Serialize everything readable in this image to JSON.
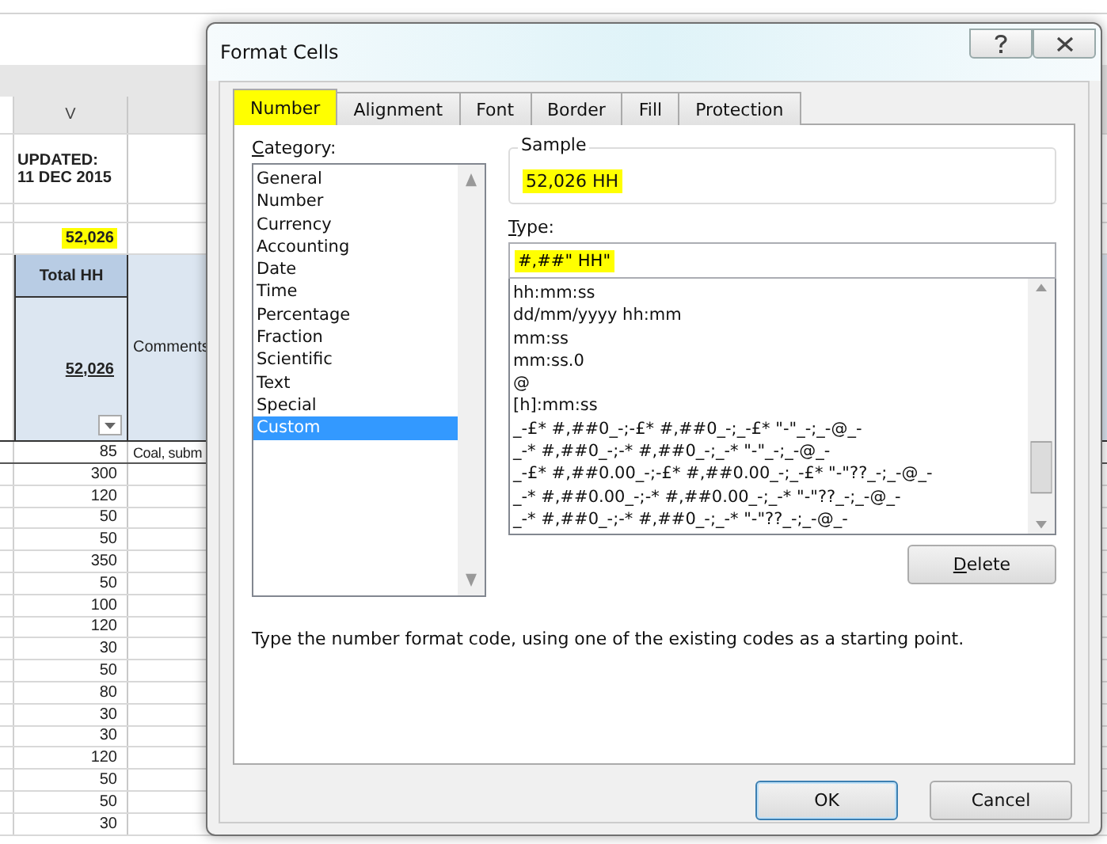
{
  "sheet": {
    "column_header": "V",
    "updated_label": "UPDATED:",
    "updated_date": "11 DEC 2015",
    "top_total": {
      "text": "52,026",
      "highlighted": true
    },
    "header": {
      "title": "Total HH",
      "total": "52,026",
      "comments_label": "Comments"
    },
    "rows": [
      {
        "total": "85",
        "comment": "Coal, subm"
      },
      {
        "total": "300"
      },
      {
        "total": "120"
      },
      {
        "total": "50"
      },
      {
        "total": "50"
      },
      {
        "total": "350"
      },
      {
        "total": "50"
      },
      {
        "total": "100"
      },
      {
        "total": "120"
      },
      {
        "total": "30"
      },
      {
        "total": "50"
      },
      {
        "total": "80"
      },
      {
        "total": "30"
      },
      {
        "total": "30"
      },
      {
        "total": "120"
      },
      {
        "total": "50"
      },
      {
        "total": "50"
      },
      {
        "total": "30"
      }
    ]
  },
  "dialog": {
    "title": "Format Cells",
    "tabs": [
      {
        "label": "Number",
        "selected": true,
        "highlighted": true
      },
      {
        "label": "Alignment",
        "selected": false,
        "highlighted": false
      },
      {
        "label": "Font",
        "selected": false,
        "highlighted": false
      },
      {
        "label": "Border",
        "selected": false,
        "highlighted": false
      },
      {
        "label": "Fill",
        "selected": false,
        "highlighted": false
      },
      {
        "label": "Protection",
        "selected": false,
        "highlighted": false
      }
    ],
    "category_label": "Category:",
    "categories": [
      {
        "label": "General",
        "selected": false
      },
      {
        "label": "Number",
        "selected": false
      },
      {
        "label": "Currency",
        "selected": false
      },
      {
        "label": "Accounting",
        "selected": false
      },
      {
        "label": "Date",
        "selected": false
      },
      {
        "label": "Time",
        "selected": false
      },
      {
        "label": "Percentage",
        "selected": false
      },
      {
        "label": "Fraction",
        "selected": false
      },
      {
        "label": "Scientific",
        "selected": false
      },
      {
        "label": "Text",
        "selected": false
      },
      {
        "label": "Special",
        "selected": false
      },
      {
        "label": "Custom",
        "selected": true
      }
    ],
    "sample_label": "Sample",
    "sample": {
      "text": "52,026 HH",
      "highlighted": true
    },
    "type_label": "Type:",
    "type_field": {
      "value": "#,##\" HH\"",
      "highlighted": true
    },
    "formats": [
      "hh:mm:ss",
      "dd/mm/yyyy hh:mm",
      "mm:ss",
      "mm:ss.0",
      "@",
      "[h]:mm:ss",
      "_-£* #,##0_-;-£* #,##0_-;_-£* \"-\"_-;_-@_-",
      "_-* #,##0_-;-* #,##0_-;_-* \"-\"_-;_-@_-",
      "_-£* #,##0.00_-;-£* #,##0.00_-;_-£* \"-\"??_-;_-@_-",
      "_-* #,##0.00_-;-* #,##0.00_-;_-* \"-\"??_-;_-@_-",
      "_-* #,##0_-;-* #,##0_-;_-* \"-\"??_-;_-@_-"
    ],
    "delete_button": "Delete",
    "description": "Type the number format code, using one of the existing codes as a starting point.",
    "buttons": [
      {
        "label": "OK",
        "default": true
      },
      {
        "label": "Cancel",
        "default": false
      }
    ]
  }
}
